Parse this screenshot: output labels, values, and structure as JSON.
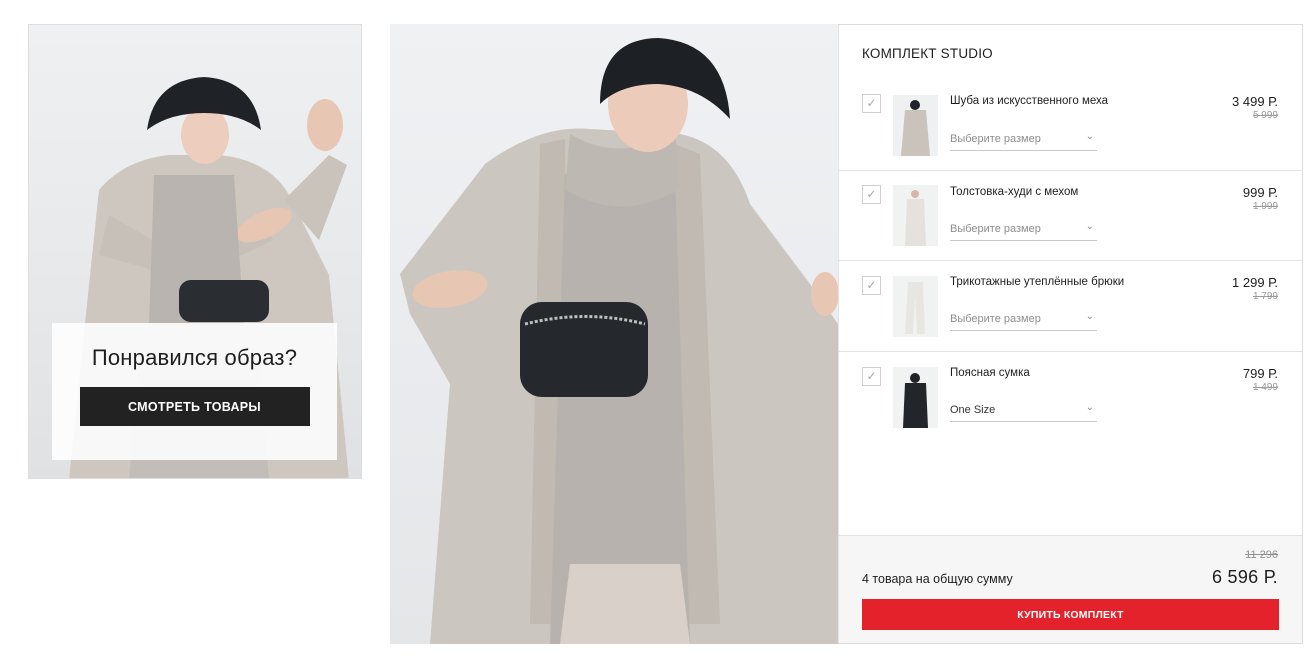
{
  "look_card": {
    "title": "Понравился образ?",
    "button_label": "СМОТРЕТЬ ТОВАРЫ"
  },
  "set": {
    "title": "КОМПЛЕКТ STUDIO",
    "items": [
      {
        "name": "Шуба из искусственного меха",
        "size": "Выберите размер",
        "price": "3 499 Р.",
        "old_price": "5 999",
        "checked": true
      },
      {
        "name": "Толстовка-худи с мехом",
        "size": "Выберите размер",
        "price": "999 Р.",
        "old_price": "1 999",
        "checked": true
      },
      {
        "name": "Трикотажные утеплённые брюки",
        "size": "Выберите размер",
        "price": "1 299 Р.",
        "old_price": "1 799",
        "checked": true
      },
      {
        "name": "Поясная сумка",
        "size": "One Size",
        "price": "799 Р.",
        "old_price": "1 499",
        "checked": true
      }
    ],
    "total_old": "11 296",
    "total_label": "4 товара на общую сумму",
    "total_price": "6 596 Р.",
    "buy_label": "КУПИТЬ КОМПЛЕКТ"
  },
  "icons": {
    "check": "✓",
    "chevron": "⌄"
  },
  "colors": {
    "accent": "#e3222b",
    "dark_button": "#222222"
  }
}
